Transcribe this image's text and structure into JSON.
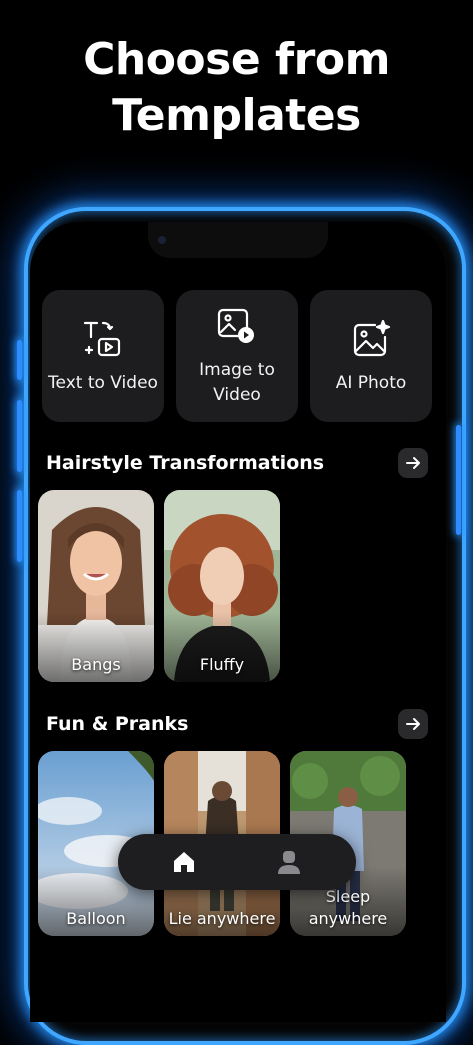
{
  "headline": {
    "line1": "Choose from",
    "line2": "Templates"
  },
  "quick_actions": [
    {
      "label": "Text to Video",
      "icon": "text-to-video-icon"
    },
    {
      "label_line1": "Image to",
      "label_line2": "Video",
      "icon": "image-to-video-icon"
    },
    {
      "label": "AI Photo",
      "icon": "ai-photo-icon"
    }
  ],
  "sections": {
    "hairstyle": {
      "title": "Hairstyle Transformations",
      "items": [
        {
          "label": "Bangs"
        },
        {
          "label": "Fluffy"
        }
      ]
    },
    "fun": {
      "title": "Fun & Pranks",
      "items": [
        {
          "label": "Balloon"
        },
        {
          "label": "Lie anywhere"
        },
        {
          "label_line1": "Sleep",
          "label_line2": "anywhere"
        }
      ]
    }
  },
  "nav": {
    "items": [
      {
        "icon": "home-icon",
        "active": true
      },
      {
        "icon": "profile-icon",
        "active": false
      }
    ]
  },
  "colors": {
    "glow": "#3fa7ff",
    "card_bg": "#1d1d1f",
    "background": "#000000"
  }
}
